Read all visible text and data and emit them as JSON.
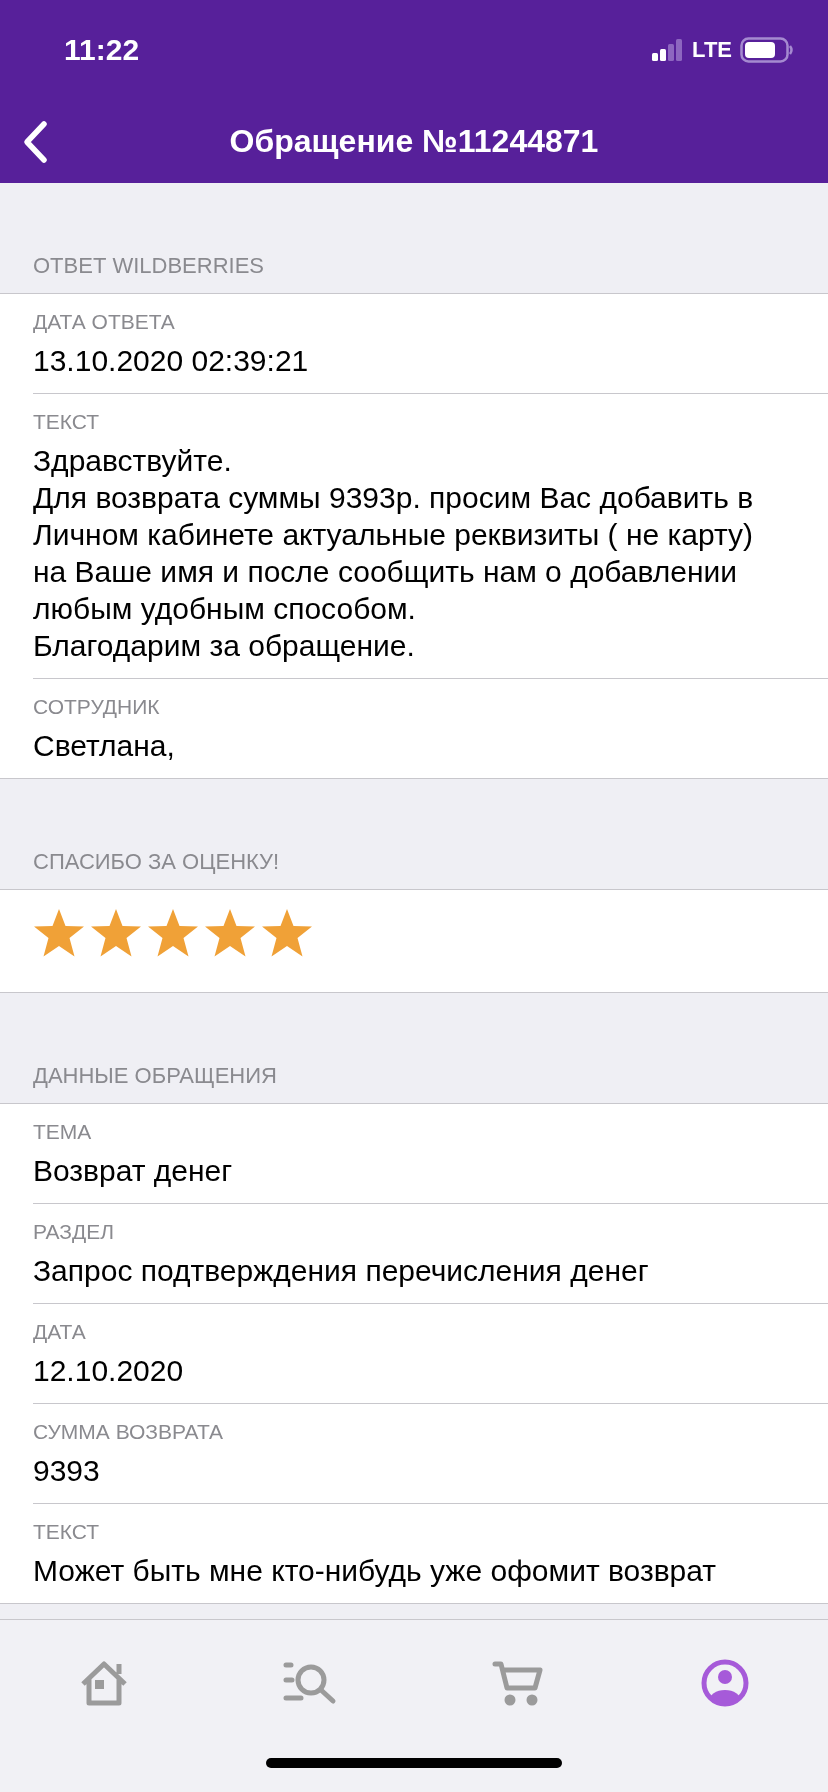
{
  "status_bar": {
    "time": "11:22",
    "network": "LTE"
  },
  "nav_bar": {
    "title": "Обращение №11244871"
  },
  "sections": [
    {
      "kind": "fields",
      "title": "ОТВЕТ WILDBERRIES",
      "rows": [
        {
          "label": "ДАТА ОТВЕТА",
          "value": "13.10.2020 02:39:21"
        },
        {
          "label": "ТЕКСТ",
          "value": "Здравствуйте.\nДля возврата суммы 9393р. просим Вас добавить в Личном кабинете актуальные реквизиты ( не карту) на Ваше имя и после сообщить нам о добавлении любым удобным способом.\nБлагодарим за обращение."
        },
        {
          "label": "СОТРУДНИК",
          "value": "Светлана,"
        }
      ]
    },
    {
      "kind": "rating",
      "title": "СПАСИБО ЗА ОЦЕНКУ!",
      "stars": 5
    },
    {
      "kind": "fields",
      "title": "ДАННЫЕ ОБРАЩЕНИЯ",
      "rows": [
        {
          "label": "ТЕМА",
          "value": "Возврат денег"
        },
        {
          "label": "РАЗДЕЛ",
          "value": "Запрос подтверждения перечисления денег"
        },
        {
          "label": "ДАТА",
          "value": "12.10.2020"
        },
        {
          "label": "СУММА ВОЗВРАТА",
          "value": "9393"
        },
        {
          "label": "ТЕКСТ",
          "value": "Может быть мне кто-нибудь уже офомит возврат"
        }
      ]
    }
  ],
  "tab_bar": [
    {
      "kind": "home",
      "selected": false
    },
    {
      "kind": "catalog",
      "selected": false
    },
    {
      "kind": "cart",
      "selected": false
    },
    {
      "kind": "profile",
      "selected": true
    }
  ]
}
